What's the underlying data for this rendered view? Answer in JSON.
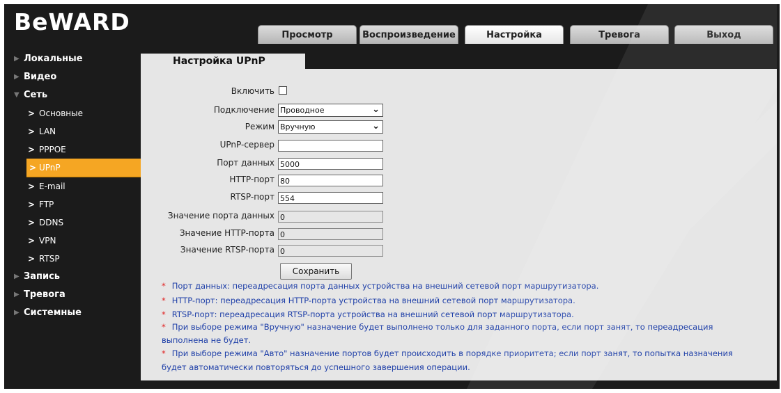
{
  "logo": "BeWARD",
  "tabs": [
    {
      "label": "Просмотр",
      "active": false
    },
    {
      "label": "Воспроизведение",
      "active": false
    },
    {
      "label": "Настройка",
      "active": true
    },
    {
      "label": "Тревога",
      "active": false
    },
    {
      "label": "Выход",
      "active": false
    }
  ],
  "sidebar": [
    {
      "label": "Локальные",
      "type": "top"
    },
    {
      "label": "Видео",
      "type": "top"
    },
    {
      "label": "Сеть",
      "type": "top",
      "expanded": true
    },
    {
      "label": "Основные",
      "type": "sub"
    },
    {
      "label": "LAN",
      "type": "sub"
    },
    {
      "label": "PPPOE",
      "type": "sub"
    },
    {
      "label": "UPnP",
      "type": "sub",
      "active": true
    },
    {
      "label": "E-mail",
      "type": "sub"
    },
    {
      "label": "FTP",
      "type": "sub"
    },
    {
      "label": "DDNS",
      "type": "sub"
    },
    {
      "label": "VPN",
      "type": "sub"
    },
    {
      "label": "RTSP",
      "type": "sub"
    },
    {
      "label": "Запись",
      "type": "top"
    },
    {
      "label": "Тревога",
      "type": "top"
    },
    {
      "label": "Системные",
      "type": "top"
    }
  ],
  "page_title": "Настройка UPnP",
  "form": {
    "enable_label": "Включить",
    "enabled": false,
    "connection_label": "Подключение",
    "connection_value": "Проводное",
    "mode_label": "Режим",
    "mode_value": "Вручную",
    "server_label": "UPnP-сервер",
    "server_value": "",
    "data_port_label": "Порт данных",
    "data_port_value": "5000",
    "http_port_label": "HTTP-порт",
    "http_port_value": "80",
    "rtsp_port_label": "RTSP-порт",
    "rtsp_port_value": "554",
    "data_port_status_label": "Значение порта данных",
    "data_port_status_value": "0",
    "http_port_status_label": "Значение HTTP-порта",
    "http_port_status_value": "0",
    "rtsp_port_status_label": "Значение RTSP-порта",
    "rtsp_port_status_value": "0",
    "save_label": "Сохранить"
  },
  "notes": [
    "Порт данных: переадресация порта данных устройства на внешний сетевой порт маршрутизатора.",
    "HTTP-порт: переадресация HTTP-порта устройства на внешний сетевой порт маршрутизатора.",
    "RTSP-порт: переадресация RTSP-порта устройства на внешний сетевой порт маршрутизатора.",
    "При выборе режима \"Вручную\" назначение будет выполнено только для заданного порта, если порт занят, то переадресация",
    "выполнена не будет.",
    "При выборе режима \"Авто\" назначение портов будет происходить в порядке приоритета; если порт занят, то попытка назначения",
    "будет автоматически повторяться до успешного завершения операции."
  ]
}
